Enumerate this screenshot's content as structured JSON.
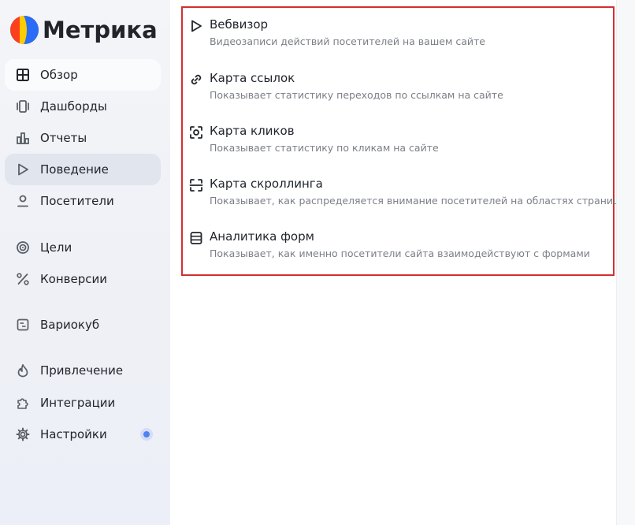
{
  "app": {
    "title": "Метрика"
  },
  "sidebar": {
    "items": [
      {
        "label": "Обзор",
        "icon": "grid-icon"
      },
      {
        "label": "Дашборды",
        "icon": "dashboards-icon"
      },
      {
        "label": "Отчеты",
        "icon": "bar-chart-icon"
      },
      {
        "label": "Поведение",
        "icon": "play-icon"
      },
      {
        "label": "Посетители",
        "icon": "person-icon"
      },
      {
        "label": "Цели",
        "icon": "target-icon"
      },
      {
        "label": "Конверсии",
        "icon": "percent-icon"
      },
      {
        "label": "Вариокуб",
        "icon": "variocube-icon"
      },
      {
        "label": "Привлечение",
        "icon": "flame-icon"
      },
      {
        "label": "Интеграции",
        "icon": "puzzle-icon"
      },
      {
        "label": "Настройки",
        "icon": "gear-icon"
      }
    ]
  },
  "behavior_menu": {
    "items": [
      {
        "title": "Вебвизор",
        "description": "Видеозаписи действий посетителей на вашем сайте",
        "icon": "play-outline-icon"
      },
      {
        "title": "Карта ссылок",
        "description": "Показывает статистику переходов по ссылкам на сайте",
        "icon": "link-icon"
      },
      {
        "title": "Карта кликов",
        "description": "Показывает статистику по кликам на сайте",
        "icon": "click-target-icon"
      },
      {
        "title": "Карта скроллинга",
        "description": "Показывает, как распределяется внимание посетителей на областях страницы",
        "icon": "scroll-frame-icon"
      },
      {
        "title": "Аналитика форм",
        "description": "Показывает, как именно посетители сайта взаимодействуют с формами",
        "icon": "form-icon"
      }
    ]
  },
  "colors": {
    "highlight_border": "#d32f2f",
    "notification_dot": "#4c83f0",
    "logo_red": "#fc3f1d",
    "logo_yellow": "#ffcc00",
    "logo_blue": "#2b6cf6"
  }
}
